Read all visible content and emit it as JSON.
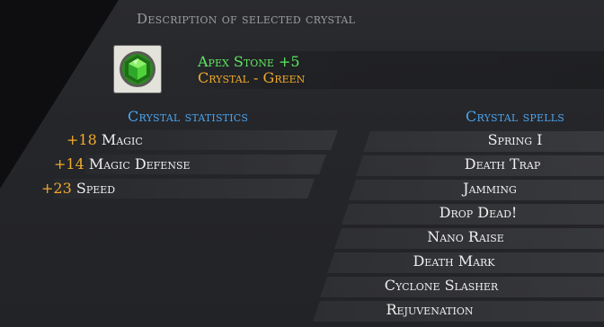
{
  "header": {
    "title": "Description of selected crystal"
  },
  "crystal": {
    "icon": "green-hexagonal-gem-icon",
    "name": "Apex Stone +5",
    "type": "Crystal - Green",
    "colors": {
      "name": "#5fe862",
      "type": "#f0aa2a"
    }
  },
  "statistics": {
    "title": "Crystal statistics",
    "items": [
      {
        "value": "+18",
        "label": "Magic"
      },
      {
        "value": "+14",
        "label": "Magic Defense"
      },
      {
        "value": "+23",
        "label": "Speed"
      }
    ]
  },
  "spells": {
    "title": "Crystal spells",
    "items": [
      "Spring I",
      "Death Trap",
      "Jamming",
      "Drop Dead!",
      "Nano Raise",
      "Death Mark",
      "Cyclone Slasher",
      "Rejuvenation"
    ]
  },
  "colors": {
    "section_title": "#4aa4ee",
    "stat_value": "#f0aa2a",
    "text": "#efefef"
  }
}
